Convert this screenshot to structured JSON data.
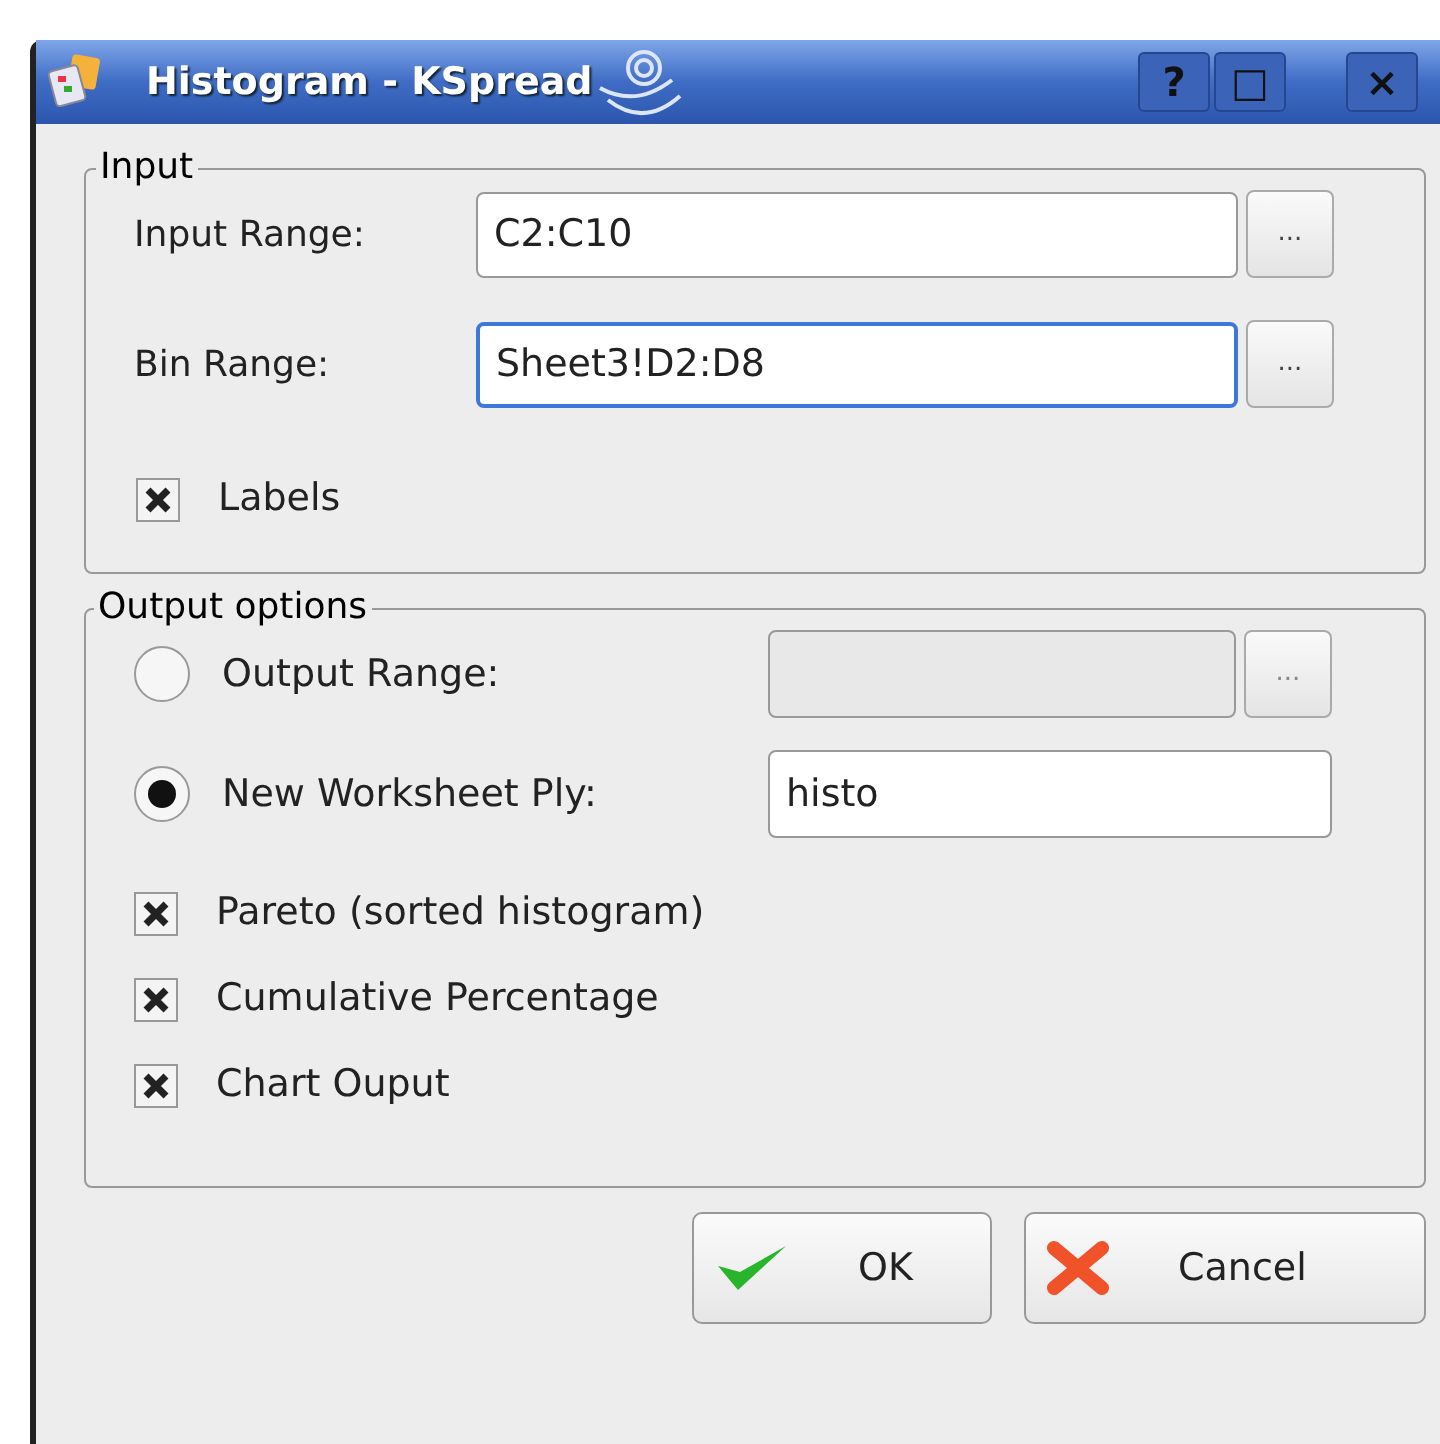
{
  "window": {
    "title": "Histogram - KSpread",
    "buttons": [
      "?",
      "□",
      "×"
    ]
  },
  "input_group": {
    "title": "Input",
    "fields": [
      {
        "label": "Input Range:",
        "value": "C2:C10",
        "focused": false,
        "button": "..."
      },
      {
        "label": "Bin Range:",
        "value": "Sheet3!D2:D8",
        "focused": true,
        "button": "..."
      }
    ],
    "checkboxes": [
      {
        "label": "Labels",
        "checked": true
      }
    ]
  },
  "output_group": {
    "title": "Output options",
    "radios": [
      {
        "label": "Output Range:",
        "selected": false,
        "disabled": true,
        "button": "..."
      },
      {
        "label": "New Worksheet Ply:",
        "selected": true,
        "value": "histo",
        "disabled": false
      }
    ],
    "checkboxes": [
      {
        "label": "Pareto (sorted histogram)",
        "checked": true
      },
      {
        "label": "Cumulative Percentage",
        "checked": true
      },
      {
        "label": "Chart Ouput",
        "checked": true
      }
    ]
  },
  "buttons": [
    {
      "kind": "ok",
      "label": "OK"
    },
    {
      "kind": "cancel",
      "label": "Cancel"
    }
  ]
}
